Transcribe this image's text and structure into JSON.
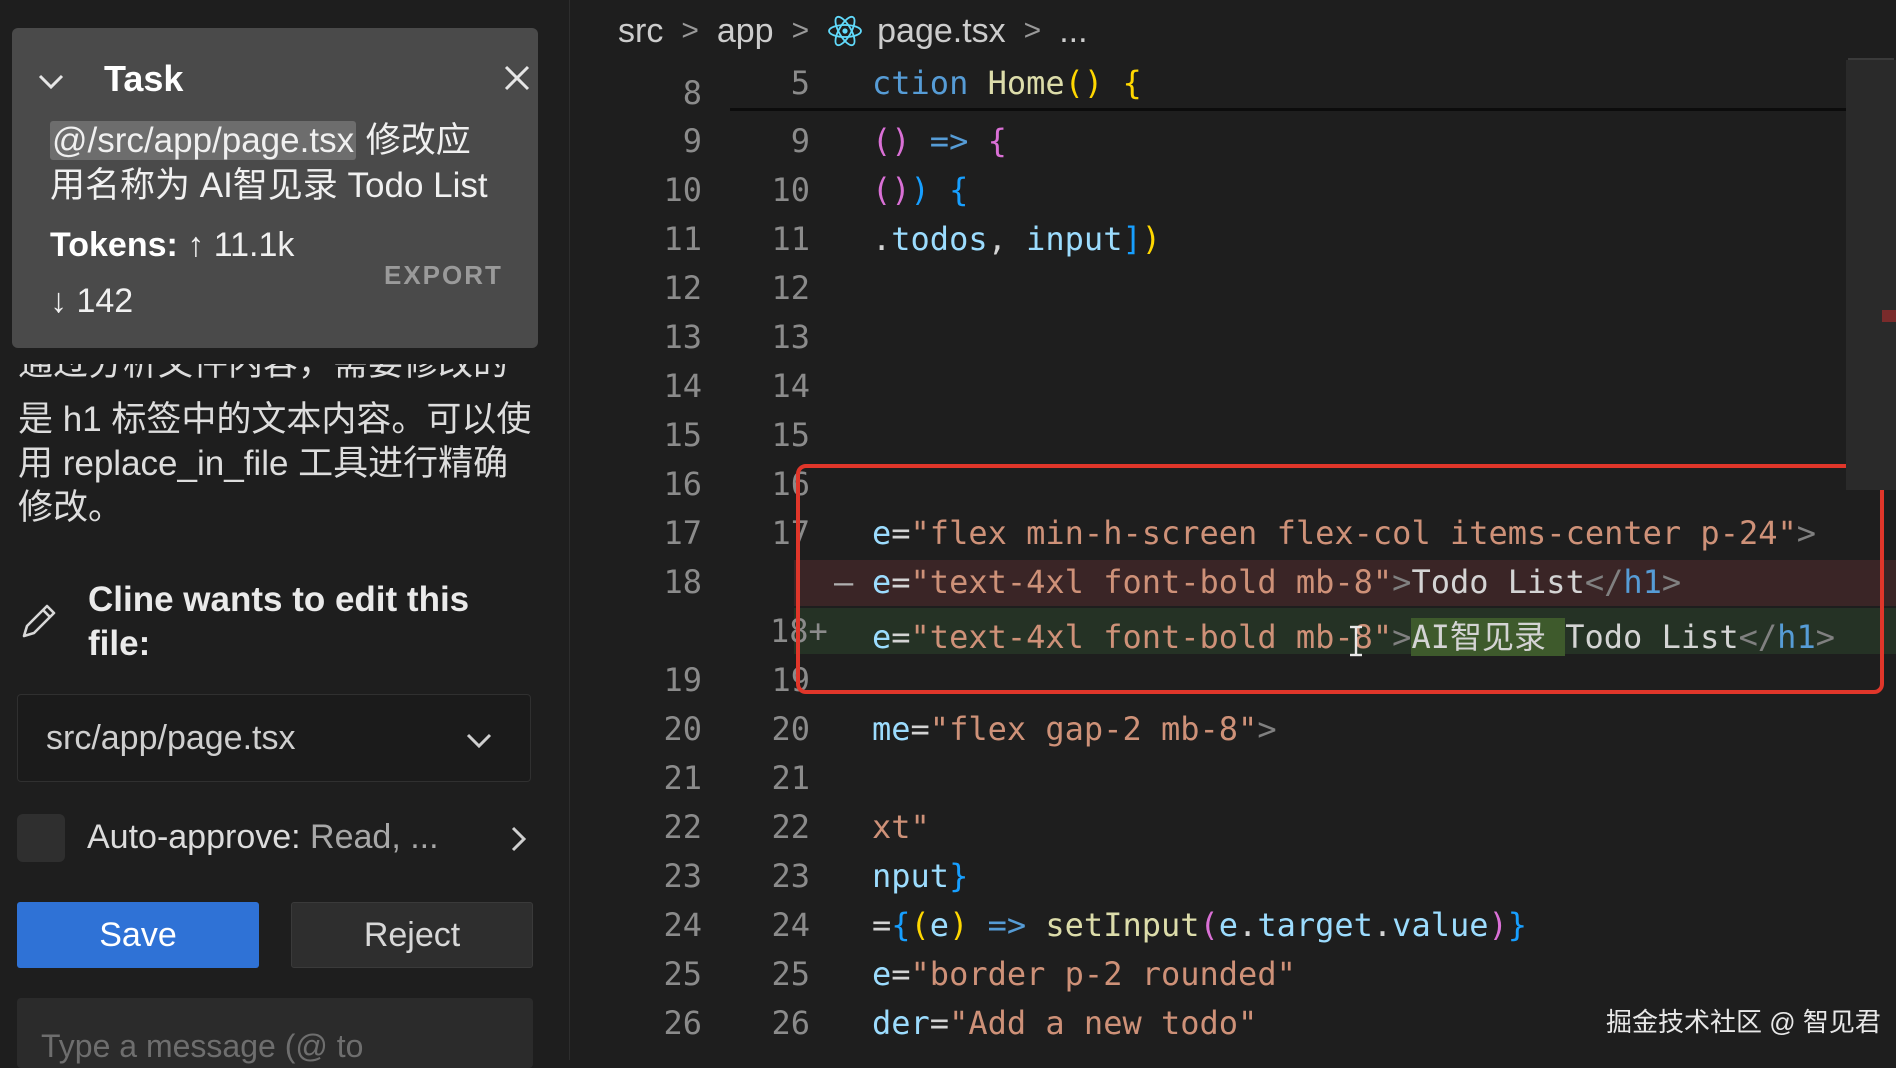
{
  "task": {
    "title": "Task",
    "mention": "@/src/app/page.tsx",
    "desc_rest_line1": " 修改应",
    "desc_line2": "用名称为 AI智见录 Todo List",
    "tokens_label": "Tokens:",
    "tokens_up": "↑ 11.1k",
    "tokens_down": "↓ 142",
    "export_label": "EXPORT"
  },
  "message": {
    "cut_line": "通过分析文件内容，需要修改的",
    "line1": "是 h1 标签中的文本内容。可以使",
    "line2": "用 replace_in_file 工具进行精确",
    "line3": "修改。"
  },
  "edit": {
    "label_line1": "Cline wants to edit this",
    "label_line2": "file:",
    "file_path": "src/app/page.tsx"
  },
  "auto_approve": {
    "label": "Auto-approve:",
    "value": "Read, ..."
  },
  "buttons": {
    "save": "Save",
    "reject": "Reject"
  },
  "input": {
    "placeholder": "Type a message (@ to"
  },
  "breadcrumb": {
    "src": "src",
    "app": "app",
    "file": "page.tsx",
    "more": "..."
  },
  "editor": {
    "sticky_line": "5",
    "old_lines": [
      "8",
      "9",
      "10",
      "11",
      "12",
      "13",
      "14",
      "15",
      "16",
      "17",
      "18",
      "",
      "19",
      "20",
      "21",
      "22",
      "23",
      "24",
      "25",
      "26"
    ],
    "new_lines": [
      "9",
      "10",
      "11",
      "12",
      "13",
      "14",
      "15",
      "16",
      "17",
      "18+",
      "19",
      "20",
      "21",
      "22",
      "23",
      "24",
      "25",
      "26"
    ],
    "line18_del_marker": "—",
    "watermark": "掘金技术社区 @ 智见君"
  },
  "colors": {
    "accent": "#2f72d6",
    "annotation": "#e0362a",
    "deleted_bg": "#3a2526",
    "added_bg": "#253225"
  }
}
